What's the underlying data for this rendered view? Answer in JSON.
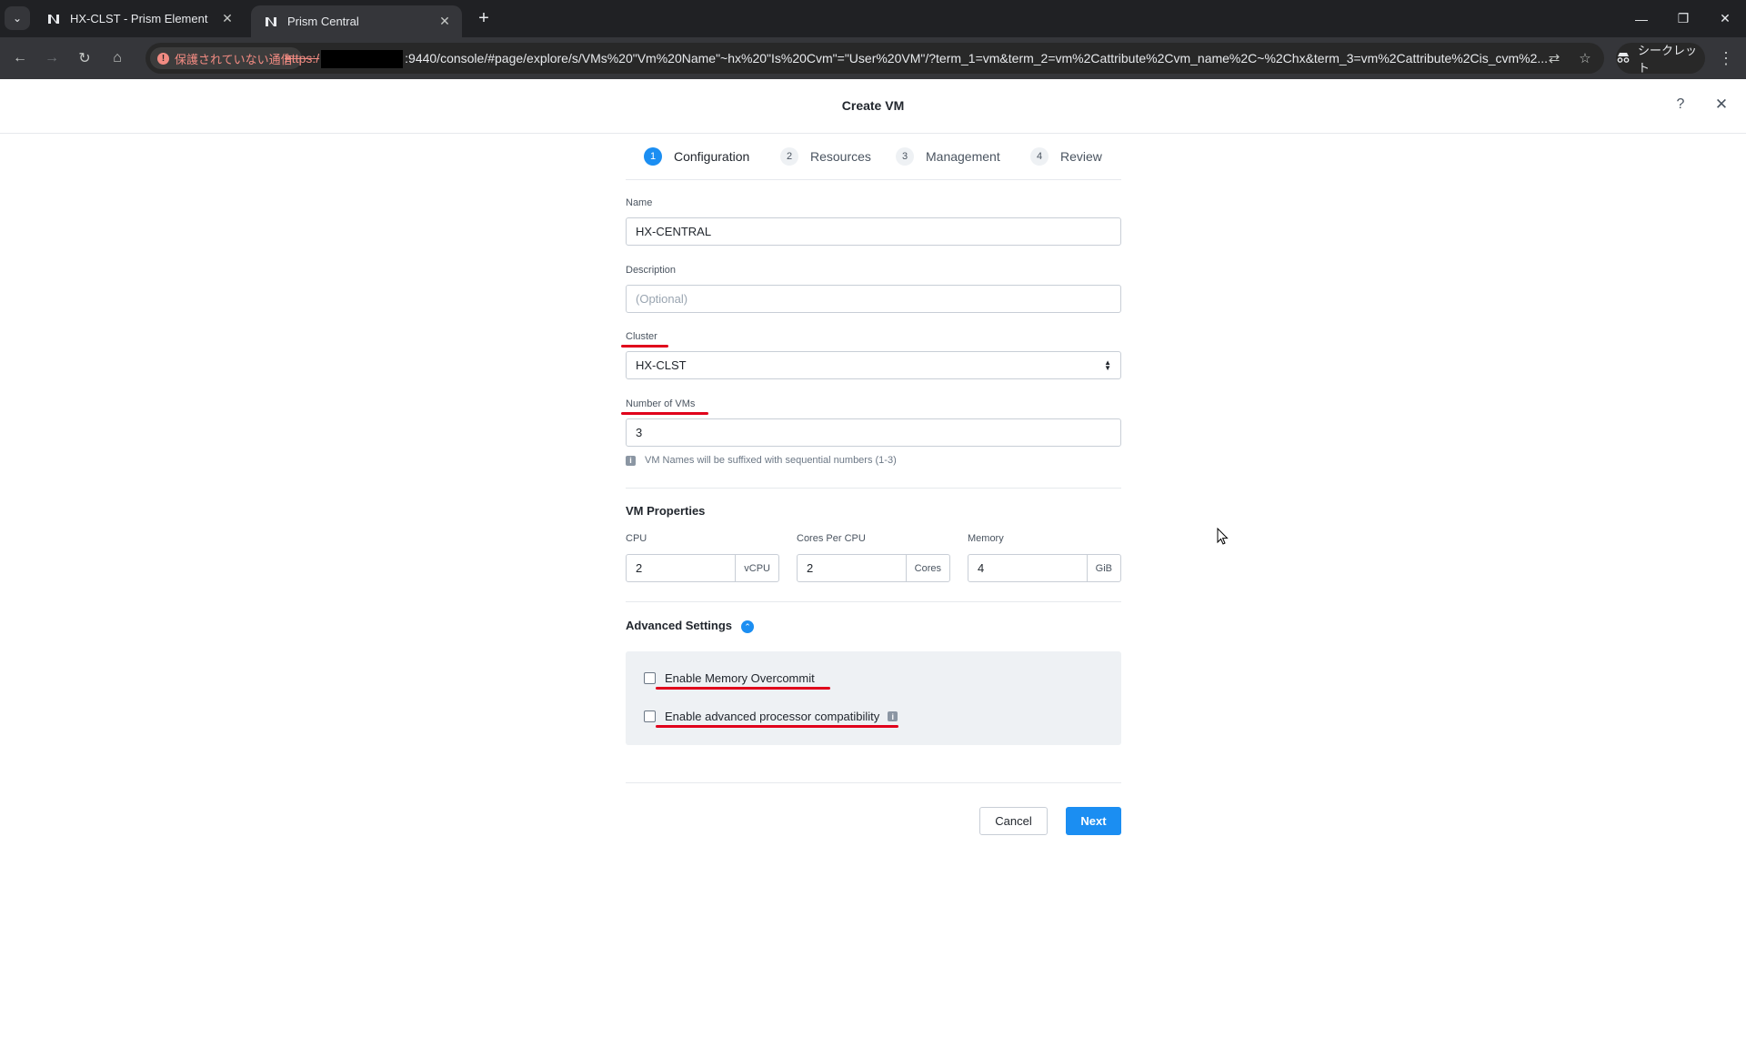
{
  "browser": {
    "tabs": [
      {
        "title": "HX-CLST - Prism Element",
        "active": false
      },
      {
        "title": "Prism Central",
        "active": true
      }
    ],
    "security_chip": "保護されていない通信",
    "url_scheme": "https:/",
    "url_rest": ":9440/console/#page/explore/s/VMs%20\"Vm%20Name\"~hx%20\"Is%20Cvm\"=\"User%20VM\"/?term_1=vm&term_2=vm%2Cattribute%2Cvm_name%2C~%2Chx&term_3=vm%2Cattribute%2Cis_cvm%2...",
    "incognito_label": "シークレット"
  },
  "modal": {
    "title": "Create VM",
    "help_label": "?",
    "steps": [
      {
        "num": "1",
        "label": "Configuration"
      },
      {
        "num": "2",
        "label": "Resources"
      },
      {
        "num": "3",
        "label": "Management"
      },
      {
        "num": "4",
        "label": "Review"
      }
    ]
  },
  "form": {
    "name_label": "Name",
    "name_value": "HX-CENTRAL",
    "description_label": "Description",
    "description_placeholder": "(Optional)",
    "cluster_label": "Cluster",
    "cluster_value": "HX-CLST",
    "num_vms_label": "Number of VMs",
    "num_vms_value": "3",
    "num_vms_hint": "VM Names will be suffixed with sequential numbers (1-3)",
    "vm_properties_title": "VM Properties",
    "cpu_label": "CPU",
    "cpu_value": "2",
    "cpu_unit": "vCPU",
    "cores_label": "Cores Per CPU",
    "cores_value": "2",
    "cores_unit": "Cores",
    "memory_label": "Memory",
    "memory_value": "4",
    "memory_unit": "GiB",
    "advanced_title": "Advanced Settings",
    "memory_overcommit_label": "Enable Memory Overcommit",
    "processor_compat_label": "Enable advanced processor compatibility",
    "cancel_label": "Cancel",
    "next_label": "Next"
  },
  "colors": {
    "accent": "#1b8ef2",
    "annotation_red": "#e0001b"
  }
}
